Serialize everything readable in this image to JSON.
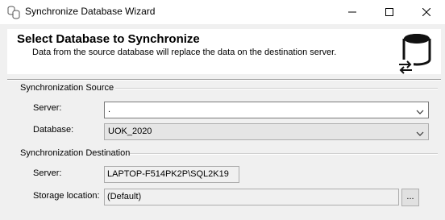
{
  "window": {
    "title": "Synchronize Database Wizard",
    "icon": "database-sync-icon"
  },
  "header": {
    "title": "Select Database to Synchronize",
    "description": "Data from the source database will replace the data on the destination server.",
    "art_icon": "database-sync-arrows-icon"
  },
  "source": {
    "group_label": "Synchronization Source",
    "server_label": "Server:",
    "server_value": ".",
    "database_label": "Database:",
    "database_value": "UOK_2020"
  },
  "destination": {
    "group_label": "Synchronization Destination",
    "server_label": "Server:",
    "server_value": "LAPTOP-F514PK2P\\SQL2K19",
    "storage_label": "Storage location:",
    "storage_value": "(Default)",
    "browse_label": "..."
  }
}
